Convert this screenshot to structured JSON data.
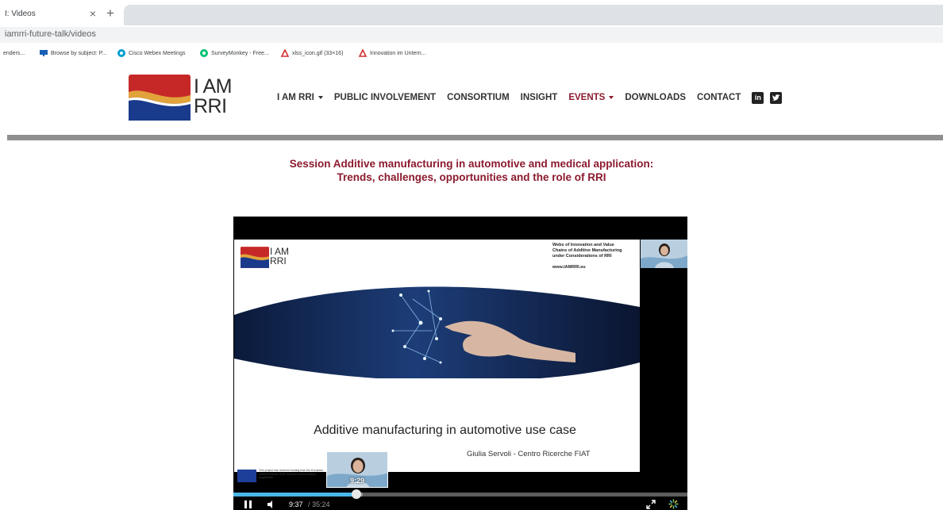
{
  "browser": {
    "tab_title": "I: Videos",
    "tab_close": "×",
    "new_tab": "+",
    "address": "iamrri-future-talk/videos",
    "bookmarks": [
      {
        "label": "enders...",
        "icon": "none"
      },
      {
        "label": "Browse by subject: P...",
        "icon": "monitor-icon",
        "color": "#1a5fb4"
      },
      {
        "label": "Cisco Webex Meetings",
        "icon": "webex-icon",
        "color": "#00a0d1"
      },
      {
        "label": "SurveyMonkey - Free...",
        "icon": "surveymonkey-icon",
        "color": "#00bf6f"
      },
      {
        "label": "xlss_icon.gif (33×16)",
        "icon": "acrobat-icon",
        "color": "#d32f2f"
      },
      {
        "label": "Innovation im Untern...",
        "icon": "acrobat-icon",
        "color": "#d32f2f"
      }
    ]
  },
  "site": {
    "logo_line1": "I AM",
    "logo_line2": "RRI",
    "nav": [
      {
        "label": "I AM RRI",
        "dropdown": true,
        "active": false
      },
      {
        "label": "PUBLIC INVOLVEMENT",
        "dropdown": false,
        "active": false
      },
      {
        "label": "CONSORTIUM",
        "dropdown": false,
        "active": false
      },
      {
        "label": "INSIGHT",
        "dropdown": false,
        "active": false
      },
      {
        "label": "EVENTS",
        "dropdown": true,
        "active": true
      },
      {
        "label": "DOWNLOADS",
        "dropdown": false,
        "active": false
      },
      {
        "label": "CONTACT",
        "dropdown": false,
        "active": false
      }
    ],
    "social": {
      "linkedin": "in",
      "twitter": "twitter-icon"
    },
    "colors": {
      "accent": "#8b1a2e",
      "nav_text": "#333333",
      "rule": "#8f8f8f"
    }
  },
  "page": {
    "title_line1": "Session Additive manufacturing in automotive and medical application:",
    "title_line2": "Trends, challenges, opportunities and the role of RRI"
  },
  "video": {
    "slide": {
      "logo_line1": "I AM",
      "logo_line2": "RRI",
      "info_line1": "Webs of Innovation and Value",
      "info_line2": "Chains of Additive Manufacturing",
      "info_line3": "under Considerations of RRI",
      "url": "www.IAMRRI.eu",
      "heading": "Additive manufacturing in automotive use case",
      "author": "Giulia Servoli - Centro Ricerche FIAT",
      "eu_text": "This project has received funding from the European Union's Horizon 2020 research and innovation programme"
    },
    "thumbnail_time": "9:29",
    "current_time": "9:37",
    "duration_text": "/ 35:24",
    "progress": 0.2711,
    "buffered": 0.285
  }
}
